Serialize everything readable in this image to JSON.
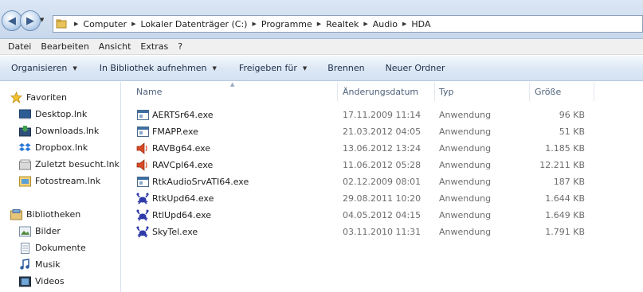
{
  "address": {
    "crumbs": [
      "Computer",
      "Lokaler Datenträger (C:)",
      "Programme",
      "Realtek",
      "Audio",
      "HDA"
    ]
  },
  "menu": [
    "Datei",
    "Bearbeiten",
    "Ansicht",
    "Extras",
    "?"
  ],
  "commands": [
    {
      "label": "Organisieren",
      "dropdown": true
    },
    {
      "label": "In Bibliothek aufnehmen",
      "dropdown": true
    },
    {
      "label": "Freigeben für",
      "dropdown": true
    },
    {
      "label": "Brennen",
      "dropdown": false
    },
    {
      "label": "Neuer Ordner",
      "dropdown": false
    }
  ],
  "nav": {
    "favorites_label": "Favoriten",
    "favorites": [
      "Desktop.lnk",
      "Downloads.lnk",
      "Dropbox.lnk",
      "Zuletzt besucht.lnk",
      "Fotostream.lnk"
    ],
    "libraries_label": "Bibliotheken",
    "libraries": [
      "Bilder",
      "Dokumente",
      "Musik",
      "Videos"
    ]
  },
  "columns": {
    "name": "Name",
    "date": "Änderungsdatum",
    "type": "Typ",
    "size": "Größe"
  },
  "files": [
    {
      "name": "AERTSr64.exe",
      "date": "17.11.2009 11:14",
      "type": "Anwendung",
      "size": "96 KB",
      "icon": "app-window-icon"
    },
    {
      "name": "FMAPP.exe",
      "date": "21.03.2012 04:05",
      "type": "Anwendung",
      "size": "51 KB",
      "icon": "app-window-icon"
    },
    {
      "name": "RAVBg64.exe",
      "date": "13.06.2012 13:24",
      "type": "Anwendung",
      "size": "1.185 KB",
      "icon": "speaker-icon"
    },
    {
      "name": "RAVCpl64.exe",
      "date": "11.06.2012 05:28",
      "type": "Anwendung",
      "size": "12.211 KB",
      "icon": "speaker-icon"
    },
    {
      "name": "RtkAudioSrvATI64.exe",
      "date": "02.12.2009 08:01",
      "type": "Anwendung",
      "size": "187 KB",
      "icon": "app-window-icon"
    },
    {
      "name": "RtkUpd64.exe",
      "date": "29.08.2011 10:20",
      "type": "Anwendung",
      "size": "1.644 KB",
      "icon": "realtek-crab-icon"
    },
    {
      "name": "RtlUpd64.exe",
      "date": "04.05.2012 04:15",
      "type": "Anwendung",
      "size": "1.649 KB",
      "icon": "realtek-crab-icon"
    },
    {
      "name": "SkyTel.exe",
      "date": "03.11.2010 11:31",
      "type": "Anwendung",
      "size": "1.791 KB",
      "icon": "realtek-crab-icon"
    }
  ]
}
